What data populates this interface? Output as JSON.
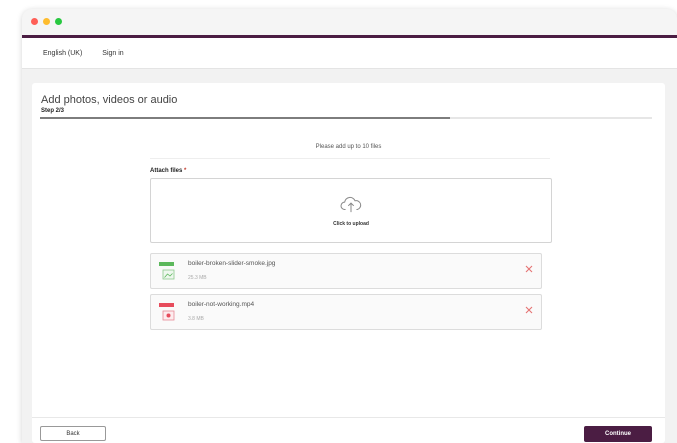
{
  "appbar": {
    "language": "English (UK)",
    "sign_in": "Sign in"
  },
  "page": {
    "title": "Add photos, videos or audio",
    "step": "Step 2/3",
    "progress_fraction": 0.67
  },
  "upload": {
    "instruction": "Please add up to 10 files",
    "attach_label": "Attach files",
    "required_marker": "*",
    "dropzone_text": "Click to upload"
  },
  "files": [
    {
      "name": "boiler-broken-slider-smoke.jpg",
      "size": "25.3 MB",
      "icon": "image-file-icon",
      "color": "#5cb85c"
    },
    {
      "name": "boiler-not-working.mp4",
      "size": "3.8 MB",
      "icon": "video-file-icon",
      "color": "#e74c5c"
    }
  ],
  "footer": {
    "back_label": "Back",
    "continue_label": "Continue"
  },
  "colors": {
    "accent": "#4b1d43",
    "remove": "#e57373"
  }
}
